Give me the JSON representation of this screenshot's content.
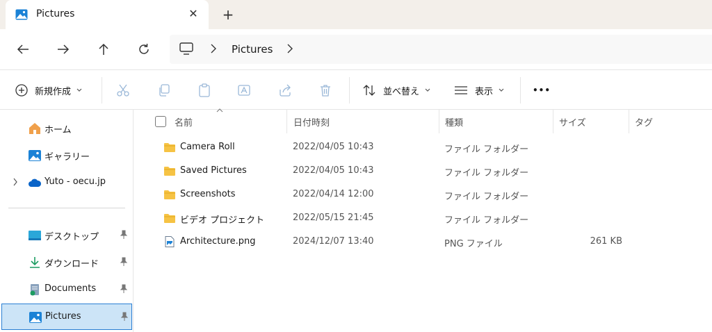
{
  "tab": {
    "title": "Pictures",
    "close": "✕",
    "new_tab": "+"
  },
  "address": {
    "location": "Pictures"
  },
  "commands": {
    "new": "新規作成",
    "sort": "並べ替え",
    "view": "表示",
    "more": "•••"
  },
  "sidebar": {
    "home": "ホーム",
    "gallery": "ギャラリー",
    "onedrive": "Yuto - oecu.jp",
    "desktop": "デスクトップ",
    "downloads": "ダウンロード",
    "documents": "Documents",
    "pictures": "Pictures"
  },
  "columns": {
    "name": "名前",
    "date": "日付時刻",
    "type": "種類",
    "size": "サイズ",
    "tags": "タグ"
  },
  "files": [
    {
      "name": "Camera Roll",
      "date": "2022/04/05 10:43",
      "type": "ファイル フォルダー",
      "size": "",
      "kind": "folder"
    },
    {
      "name": "Saved Pictures",
      "date": "2022/04/05 10:43",
      "type": "ファイル フォルダー",
      "size": "",
      "kind": "folder"
    },
    {
      "name": "Screenshots",
      "date": "2022/04/14 12:00",
      "type": "ファイル フォルダー",
      "size": "",
      "kind": "folder"
    },
    {
      "name": "ビデオ プロジェクト",
      "date": "2022/05/15 21:45",
      "type": "ファイル フォルダー",
      "size": "",
      "kind": "folder"
    },
    {
      "name": "Architecture.png",
      "date": "2024/12/07 13:40",
      "type": "PNG ファイル",
      "size": "261 KB",
      "kind": "png"
    }
  ],
  "colors": {
    "accent": "#0067c0",
    "selected_bg": "#cce4f7",
    "folder": "#f6c344"
  }
}
